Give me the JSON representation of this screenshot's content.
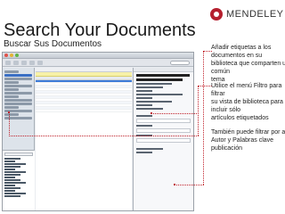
{
  "slide": {
    "title": "Search Your Documents",
    "subtitle": "Buscar Sus Documentos"
  },
  "logo": {
    "text": "MENDELEY",
    "icon": "mendeley-logo-icon",
    "color": "#b51f2e"
  },
  "annotations": [
    {
      "lines": [
        "Añadir etiquetas a los",
        "documentos en su",
        "biblioteca que comparten una",
        "común",
        "tema"
      ]
    },
    {
      "lines": [
        "Utilice el menú Filtro para",
        "filtrar",
        "su vista de biblioteca para",
        "incluir sólo",
        "artículos etiquetados"
      ]
    },
    {
      "lines": [
        "También puede filtrar por autor ,",
        "Autor y Palabras clave",
        "publicación"
      ]
    }
  ],
  "colors": {
    "accent": "#c0202a",
    "selection": "#3d7bd8",
    "banner": "#f7f1a8"
  }
}
